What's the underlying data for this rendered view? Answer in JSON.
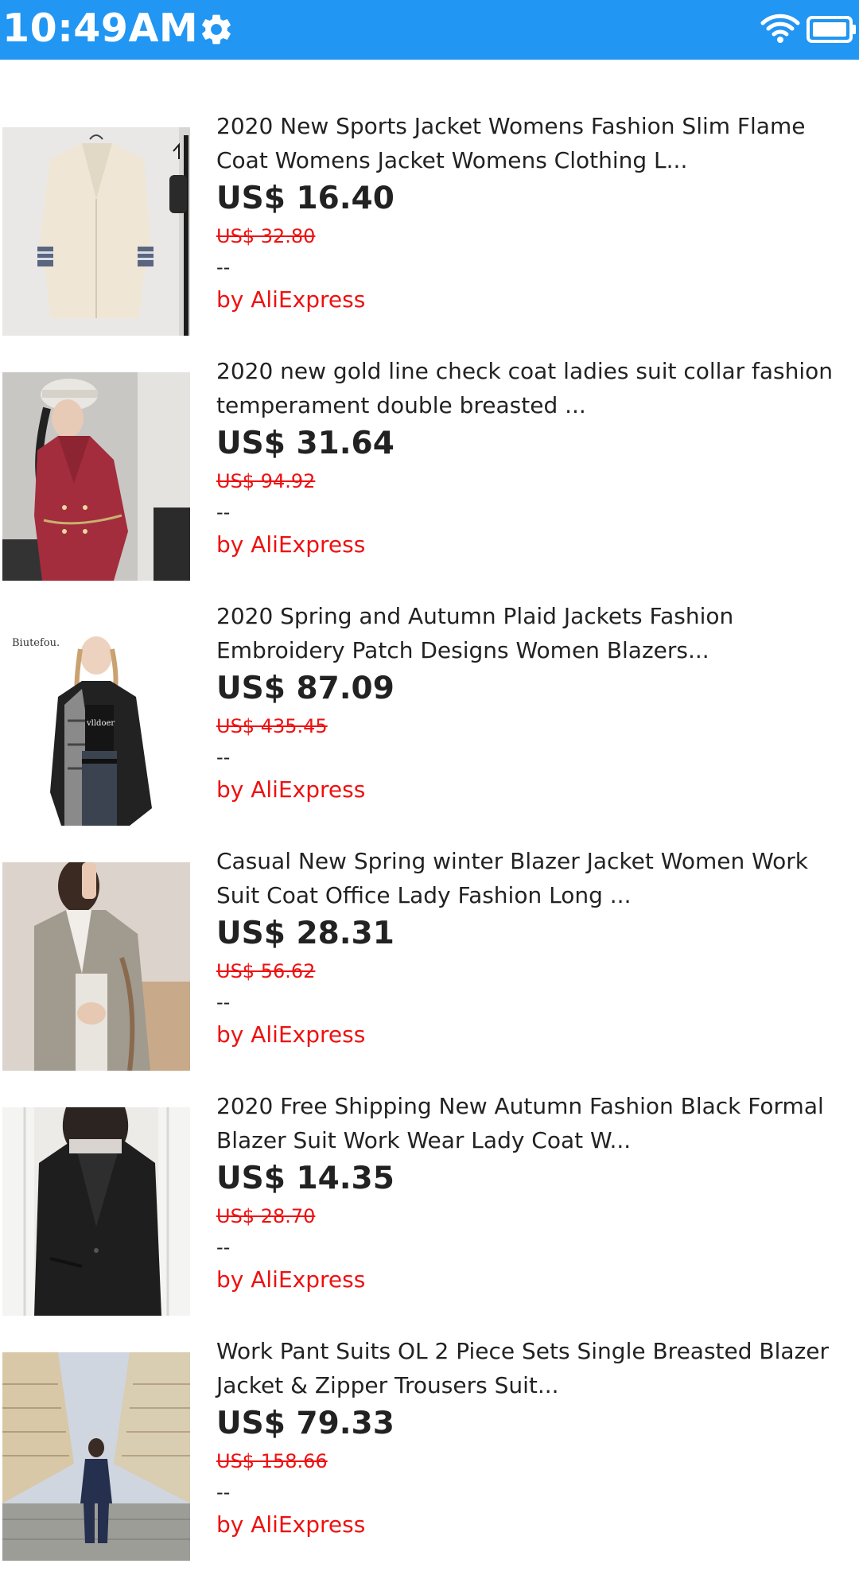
{
  "status_bar": {
    "time": "10:49AM",
    "background": "#2196f3",
    "icons": [
      "gear-icon",
      "wifi-icon",
      "battery-icon"
    ]
  },
  "products": [
    {
      "title_line1": "2020 New Sports Jacket Womens Fashion Slim Flame",
      "title_line2": "Coat Womens Jacket Womens Clothing L...",
      "price": "US$ 16.40",
      "original_price": "US$ 32.80",
      "rating": "--",
      "seller": "by AliExpress",
      "image": "beige-blazer-photo"
    },
    {
      "title_line1": "2020 new gold line check coat ladies suit collar fashion",
      "title_line2": "temperament double breasted ...",
      "price": "US$ 31.64",
      "original_price": "US$ 94.92",
      "rating": "--",
      "seller": "by AliExpress",
      "image": "red-tweed-coat-photo"
    },
    {
      "title_line1": "2020 Spring and Autumn Plaid Jackets Fashion",
      "title_line2": "Embroidery Patch Designs Women Blazers...",
      "price": "US$ 87.09",
      "original_price": "US$ 435.45",
      "rating": "--",
      "seller": "by AliExpress",
      "image": "plaid-blazer-photo",
      "image_logo_text": "Biutefou."
    },
    {
      "title_line1": "Casual New Spring winter Blazer Jacket Women Work",
      "title_line2": "Suit Coat Office Lady Fashion Long ...",
      "price": "US$ 28.31",
      "original_price": "US$ 56.62",
      "rating": "--",
      "seller": "by AliExpress",
      "image": "grey-blazer-photo"
    },
    {
      "title_line1": "2020 Free Shipping New Autumn Fashion Black Formal",
      "title_line2": "Blazer Suit Work Wear Lady Coat W...",
      "price": "US$ 14.35",
      "original_price": "US$ 28.70",
      "rating": "--",
      "seller": "by AliExpress",
      "image": "black-blazer-photo"
    },
    {
      "title_line1": "Work Pant Suits OL 2 Piece Sets Single Breasted Blazer",
      "title_line2": "Jacket & Zipper Trousers Suit...",
      "price": "US$ 79.33",
      "original_price": "US$ 158.66",
      "rating": "--",
      "seller": "by AliExpress",
      "image": "navy-pant-suit-street-photo"
    }
  ],
  "colors": {
    "accent_red": "#ee1111",
    "text": "#222222"
  }
}
